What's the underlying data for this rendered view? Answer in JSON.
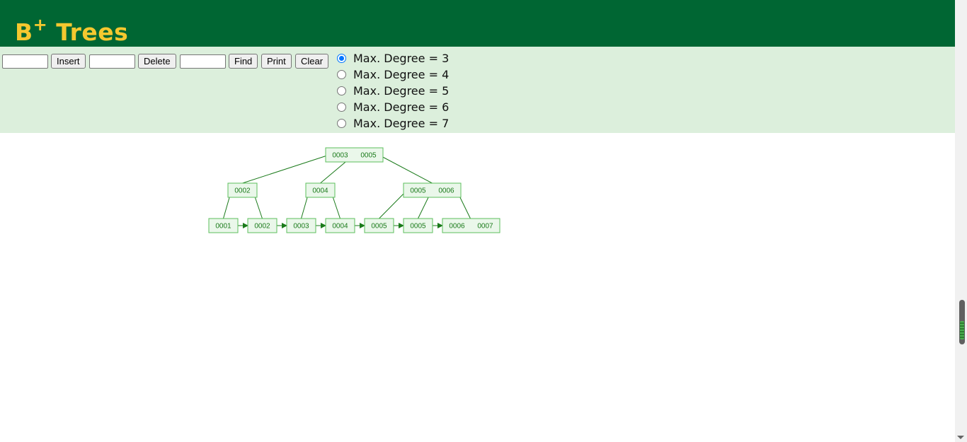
{
  "header": {
    "title_main": "B",
    "title_sup": "+",
    "title_rest": " Trees"
  },
  "controls": {
    "insert_value": "",
    "insert_label": "Insert",
    "delete_value": "",
    "delete_label": "Delete",
    "find_value": "",
    "find_label": "Find",
    "print_label": "Print",
    "clear_label": "Clear",
    "degree_options": [
      {
        "label": "Max. Degree = 3",
        "checked": true
      },
      {
        "label": "Max. Degree = 4",
        "checked": false
      },
      {
        "label": "Max. Degree = 5",
        "checked": false
      },
      {
        "label": "Max. Degree = 6",
        "checked": false
      },
      {
        "label": "Max. Degree = 7",
        "checked": false
      }
    ]
  },
  "tree": {
    "root": {
      "keys": [
        "0003",
        "0005"
      ]
    },
    "internal": [
      {
        "keys": [
          "0002"
        ]
      },
      {
        "keys": [
          "0004"
        ]
      },
      {
        "keys": [
          "0005",
          "0006"
        ]
      }
    ],
    "leaves": [
      {
        "keys": [
          "0001"
        ]
      },
      {
        "keys": [
          "0002"
        ]
      },
      {
        "keys": [
          "0003"
        ]
      },
      {
        "keys": [
          "0004"
        ]
      },
      {
        "keys": [
          "0005"
        ]
      },
      {
        "keys": [
          "0005"
        ]
      },
      {
        "keys": [
          "0006",
          "0007"
        ]
      }
    ]
  },
  "colors": {
    "header_bg": "#006633",
    "title": "#f5c82f",
    "panel_bg": "#dcefdc",
    "node_fill": "#eaf7ea",
    "node_stroke": "#5cbf5c",
    "edge": "#1a7a1a"
  }
}
